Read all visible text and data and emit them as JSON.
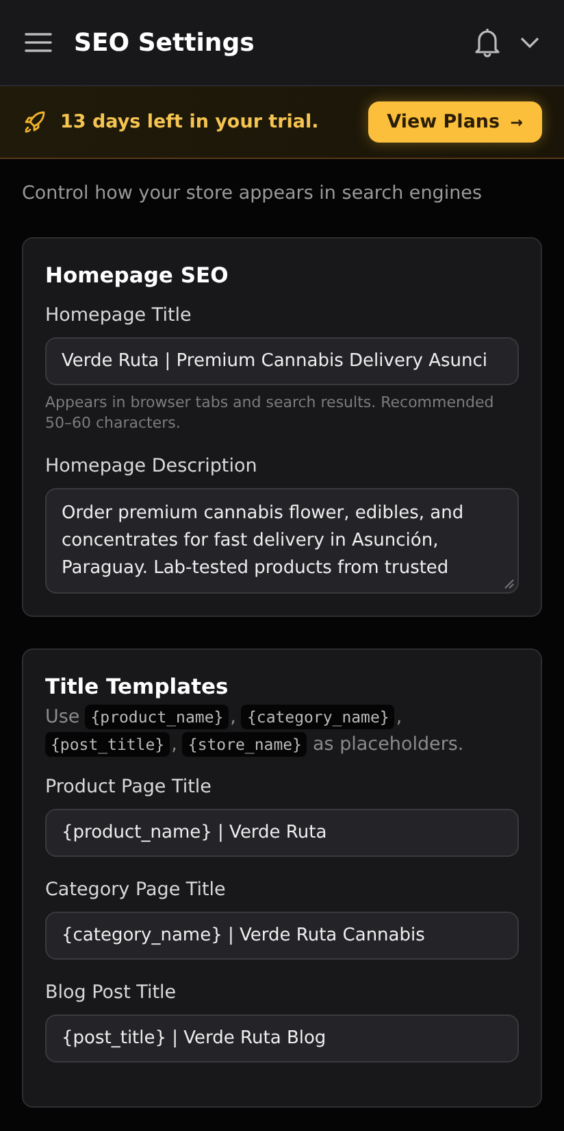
{
  "header": {
    "title": "SEO Settings"
  },
  "trial_banner": {
    "message": "13 days left in your trial.",
    "button": "View Plans",
    "button_arrow": "→"
  },
  "subtitle": "Control how your store appears in search engines",
  "homepage_seo": {
    "title": "Homepage SEO",
    "fields": [
      {
        "kind": "input",
        "label": "Homepage Title",
        "value": "Verde Ruta | Premium Cannabis Delivery Asunci",
        "help": "Appears in browser tabs and search results. Recommended 50–60 characters."
      },
      {
        "kind": "textarea",
        "label": "Homepage Description",
        "value": "Order premium cannabis flower, edibles, and concentrates for fast delivery in Asunción, Paraguay. Lab-tested products from trusted"
      }
    ]
  },
  "title_templates": {
    "title": "Title Templates",
    "hint": {
      "prefix": "Use",
      "tokens": [
        "{product_name}",
        "{category_name}",
        "{post_title}",
        "{store_name}"
      ],
      "separator": ",",
      "suffix": "as placeholders."
    },
    "fields": [
      {
        "label": "Product Page Title",
        "value": "{product_name} | Verde Ruta"
      },
      {
        "label": "Category Page Title",
        "value": "{category_name} | Verde Ruta Cannabis"
      },
      {
        "label": "Blog Post Title",
        "value": "{post_title} | Verde Ruta Blog"
      }
    ]
  }
}
